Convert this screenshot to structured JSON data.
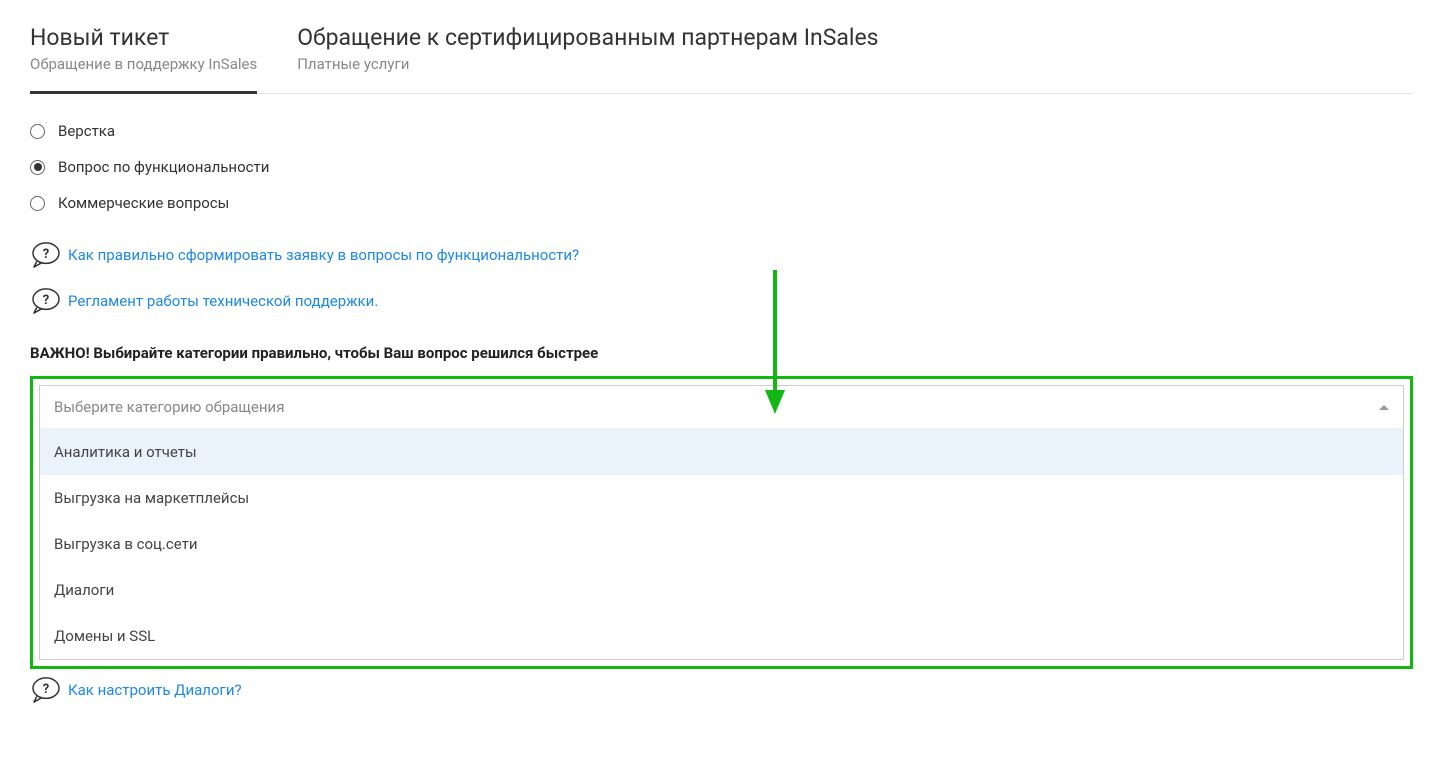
{
  "tabs": [
    {
      "title": "Новый тикет",
      "sub": "Обращение в поддержку InSales"
    },
    {
      "title": "Обращение к сертифицированным партнерам InSales",
      "sub": "Платные услуги"
    }
  ],
  "radios": [
    {
      "label": "Верстка",
      "checked": false
    },
    {
      "label": "Вопрос по функциональности",
      "checked": true
    },
    {
      "label": "Коммерческие вопросы",
      "checked": false
    }
  ],
  "help": [
    "Как правильно сформировать заявку в вопросы по функциональности?",
    "Регламент работы технической поддержки."
  ],
  "important": "ВАЖНО! Выбирайте категории правильно, чтобы Ваш вопрос решился быстрее",
  "select": {
    "placeholder": "Выберите категорию обращения",
    "options": [
      "Аналитика и отчеты",
      "Выгрузка на маркетплейсы",
      "Выгрузка в соц.сети",
      "Диалоги",
      "Домены и SSL"
    ]
  },
  "bottom_link": "Как настроить Диалоги?"
}
